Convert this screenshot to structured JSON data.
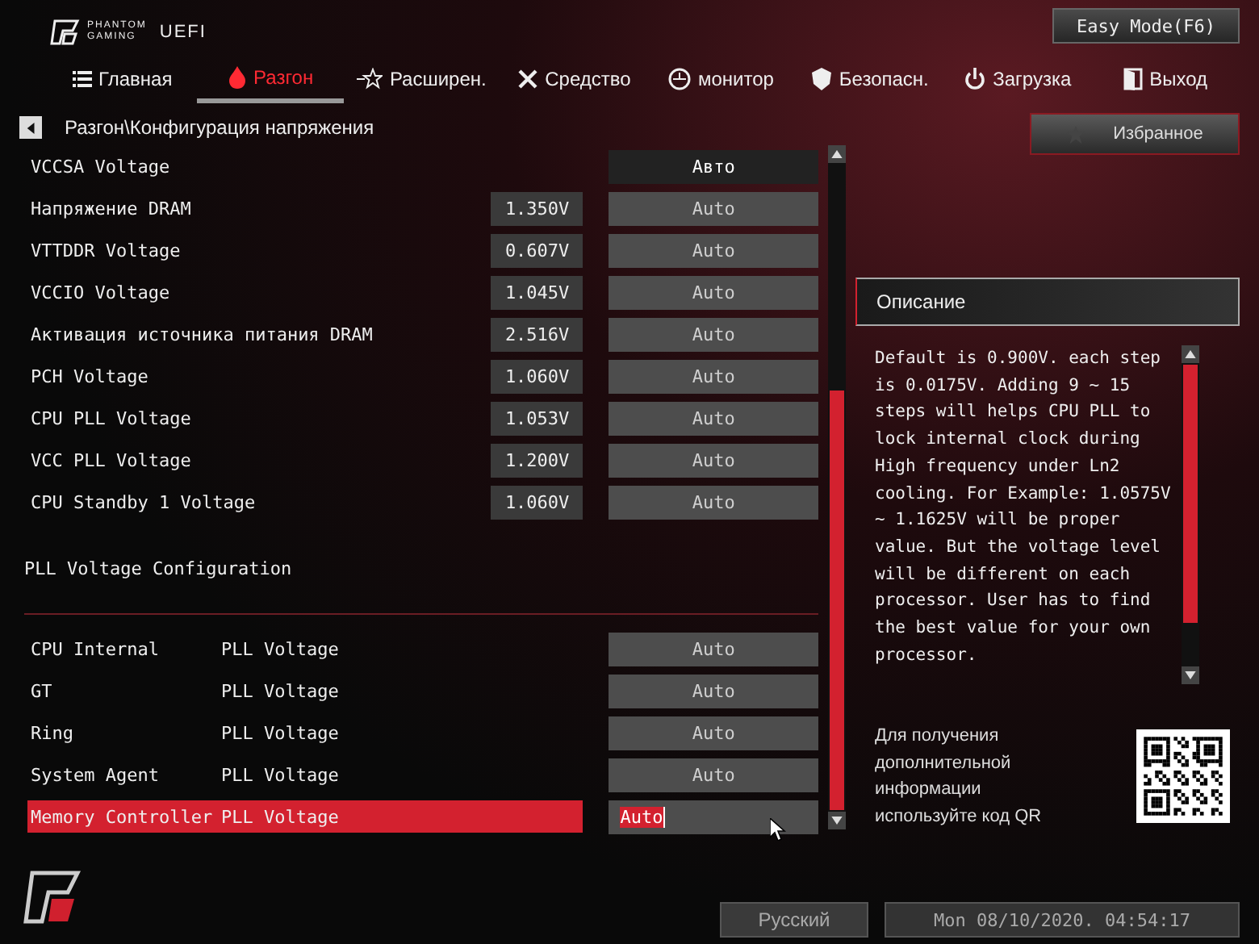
{
  "header": {
    "brand": [
      "PHANTOM",
      "GAMING"
    ],
    "product": "UEFI",
    "mode_button": "Easy Mode(F6)"
  },
  "tabs": [
    {
      "label": "Главная",
      "selected": false
    },
    {
      "label": "Разгон",
      "selected": true
    },
    {
      "label": "Расширен.",
      "selected": false
    },
    {
      "label": "Средство",
      "selected": false
    },
    {
      "label": "монитор",
      "selected": false
    },
    {
      "label": "Безопасн.",
      "selected": false
    },
    {
      "label": "Загрузка",
      "selected": false
    },
    {
      "label": "Выход",
      "selected": false
    }
  ],
  "breadcrumb": "Разгон\\Конфигурация напряжения",
  "favorites_button": "Избранное",
  "settings": [
    {
      "kind": "choice",
      "label": "VCCSA Voltage",
      "value": "Авто",
      "selected": false
    },
    {
      "kind": "voltage",
      "label": "Напряжение DRAM",
      "reading": "1.350V",
      "value": "Auto",
      "selected": false
    },
    {
      "kind": "voltage",
      "label": "VTTDDR Voltage",
      "reading": "0.607V",
      "value": "Auto",
      "selected": false
    },
    {
      "kind": "voltage",
      "label": "VCCIO Voltage",
      "reading": "1.045V",
      "value": "Auto",
      "selected": false
    },
    {
      "kind": "voltage",
      "label": "Активация источника питания DRAM",
      "reading": "2.516V",
      "value": "Auto",
      "selected": false
    },
    {
      "kind": "voltage",
      "label": "PCH Voltage",
      "reading": "1.060V",
      "value": "Auto",
      "selected": false
    },
    {
      "kind": "voltage",
      "label": "CPU PLL Voltage",
      "reading": "1.053V",
      "value": "Auto",
      "selected": false
    },
    {
      "kind": "voltage",
      "label": "VCC PLL Voltage",
      "reading": "1.200V",
      "value": "Auto",
      "selected": false
    },
    {
      "kind": "voltage",
      "label": "CPU Standby 1 Voltage",
      "reading": "1.060V",
      "value": "Auto",
      "selected": false
    },
    {
      "kind": "section",
      "label": "PLL Voltage Configuration"
    },
    {
      "kind": "pll",
      "label": "CPU Internal",
      "suffix": "PLL Voltage",
      "value": "Auto",
      "selected": false
    },
    {
      "kind": "pll",
      "label": "GT",
      "suffix": "PLL Voltage",
      "value": "Auto",
      "selected": false
    },
    {
      "kind": "pll",
      "label": "Ring",
      "suffix": "PLL Voltage",
      "value": "Auto",
      "selected": false
    },
    {
      "kind": "pll",
      "label": "System Agent",
      "suffix": "PLL Voltage",
      "value": "Auto",
      "selected": false
    },
    {
      "kind": "pll",
      "label": "Memory Controller",
      "suffix": "PLL Voltage",
      "value": "Auto",
      "selected": true
    }
  ],
  "description": {
    "title": "Описание",
    "text": "Default is 0.900V. each step is 0.0175V. Adding 9 ~ 15 steps will helps CPU PLL to lock internal clock during High frequency under Ln2 cooling. For Example: 1.0575V ~ 1.1625V will be proper value. But the voltage level will be different on each processor. User has to find the best value for your own processor."
  },
  "qr_note": "Для получения дополнительной информации используйте код QR",
  "status_bar": {
    "language": "Русский",
    "datetime": "Mon 08/10/2020. 04:54:17"
  }
}
